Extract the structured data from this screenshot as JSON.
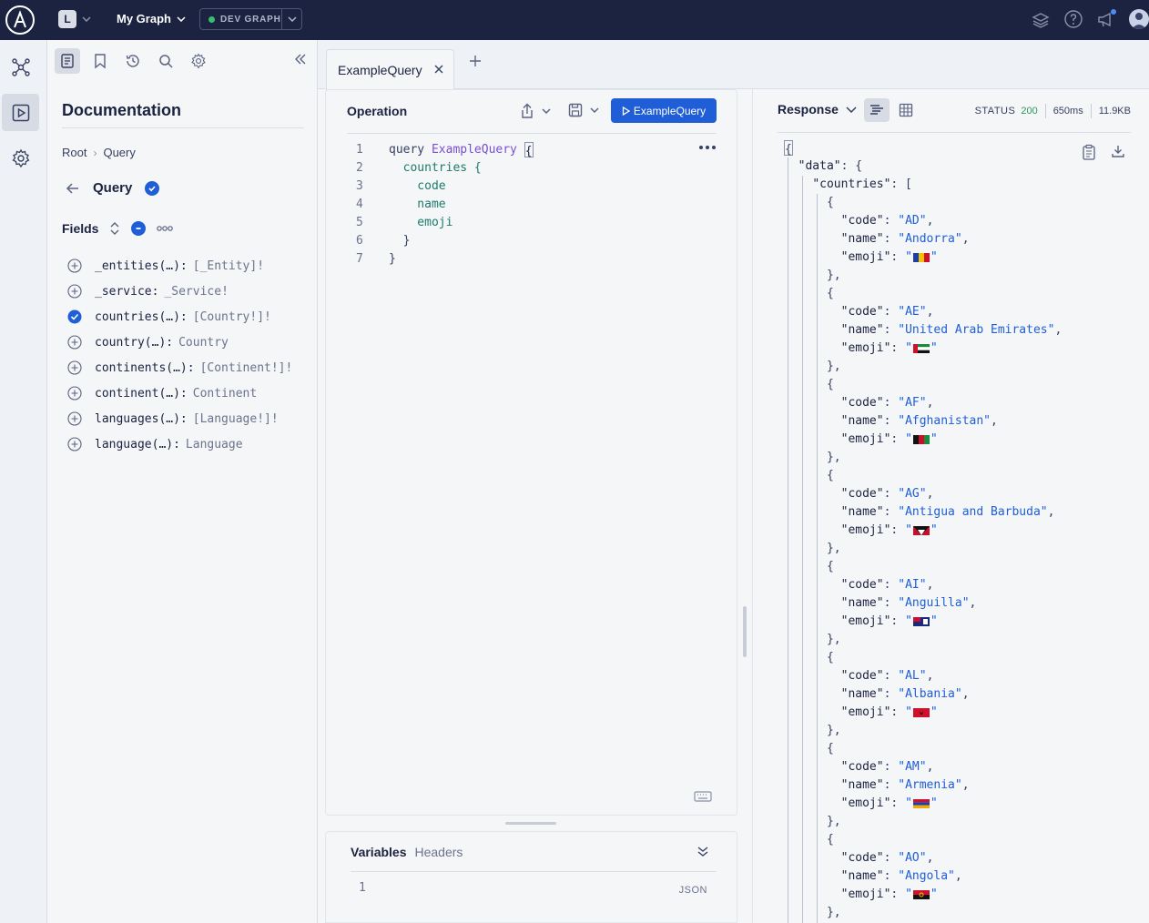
{
  "header": {
    "graph_initial": "L",
    "graph_name": "My Graph",
    "variant": "DEV GRAPH"
  },
  "docs": {
    "title": "Documentation",
    "breadcrumb": [
      "Root",
      "Query"
    ],
    "type_name": "Query",
    "fields_label": "Fields",
    "fields": [
      {
        "name": "_entities(…):",
        "type": "[_Entity]!",
        "selected": false
      },
      {
        "name": "_service:",
        "type": "_Service!",
        "selected": false
      },
      {
        "name": "countries(…):",
        "type": "[Country!]!",
        "selected": true
      },
      {
        "name": "country(…):",
        "type": "Country",
        "selected": false
      },
      {
        "name": "continents(…):",
        "type": "[Continent!]!",
        "selected": false
      },
      {
        "name": "continent(…):",
        "type": "Continent",
        "selected": false
      },
      {
        "name": "languages(…):",
        "type": "[Language!]!",
        "selected": false
      },
      {
        "name": "language(…):",
        "type": "Language",
        "selected": false
      }
    ]
  },
  "tabs": [
    {
      "label": "ExampleQuery"
    }
  ],
  "operation": {
    "title": "Operation",
    "run_label": "ExampleQuery",
    "lines": [
      {
        "n": "1",
        "kw": "query",
        "name": "ExampleQuery",
        "rest": "{"
      },
      {
        "n": "2",
        "text": "  countries {"
      },
      {
        "n": "3",
        "text": "    code"
      },
      {
        "n": "4",
        "text": "    name"
      },
      {
        "n": "5",
        "text": "    emoji"
      },
      {
        "n": "6",
        "text": "  }"
      },
      {
        "n": "7",
        "text": "}"
      }
    ]
  },
  "variables": {
    "tab_active": "Variables",
    "tab_other": "Headers",
    "line": "1",
    "format": "JSON"
  },
  "response": {
    "title": "Response",
    "status_label": "STATUS",
    "status_code": "200",
    "time": "650ms",
    "size": "11.9KB",
    "countries": [
      {
        "code": "AD",
        "name": "Andorra",
        "flag": "andorra"
      },
      {
        "code": "AE",
        "name": "United Arab Emirates",
        "flag": "uae"
      },
      {
        "code": "AF",
        "name": "Afghanistan",
        "flag": "afghanistan"
      },
      {
        "code": "AG",
        "name": "Antigua and Barbuda",
        "flag": "antigua"
      },
      {
        "code": "AI",
        "name": "Anguilla",
        "flag": "anguilla"
      },
      {
        "code": "AL",
        "name": "Albania",
        "flag": "albania"
      },
      {
        "code": "AM",
        "name": "Armenia",
        "flag": "armenia"
      },
      {
        "code": "AO",
        "name": "Angola",
        "flag": "angola"
      }
    ]
  },
  "colors": {
    "header_bg": "#1c2340",
    "accent": "#1f5ed6",
    "status_ok": "#2b9a5c"
  }
}
